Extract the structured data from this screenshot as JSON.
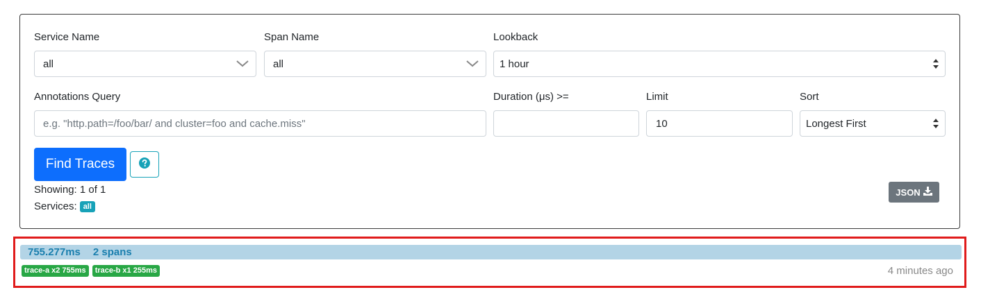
{
  "search": {
    "service_name": {
      "label": "Service Name",
      "value": "all"
    },
    "span_name": {
      "label": "Span Name",
      "value": "all"
    },
    "lookback": {
      "label": "Lookback",
      "value": "1 hour"
    },
    "annotations": {
      "label": "Annotations Query",
      "placeholder": "e.g. \"http.path=/foo/bar/ and cluster=foo and cache.miss\""
    },
    "duration": {
      "label": "Duration (μs) >=",
      "value": ""
    },
    "limit": {
      "label": "Limit",
      "value": "10"
    },
    "sort": {
      "label": "Sort",
      "value": "Longest First"
    },
    "find_label": "Find Traces",
    "help_icon": "question-circle-icon"
  },
  "summary": {
    "showing": "Showing: 1 of 1",
    "services_label": "Services:",
    "services_badge": "all",
    "json_label": "JSON",
    "json_icon": "download-icon"
  },
  "results": [
    {
      "duration": "755.277ms",
      "spans": "2 spans",
      "services": [
        "trace-a x2 755ms",
        "trace-b x1 255ms"
      ],
      "ago": "4 minutes ago"
    }
  ],
  "colors": {
    "primary": "#0d6efd",
    "info": "#17a2b8",
    "success": "#28a745",
    "secondary": "#6c757d",
    "duration_bar": "#b3d4e6",
    "highlight": "#e01b1b"
  }
}
